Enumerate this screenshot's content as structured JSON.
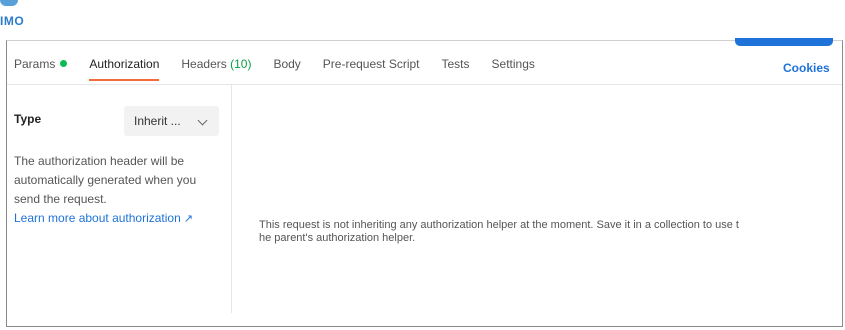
{
  "header": {
    "logo_text": "IMO"
  },
  "tabs": [
    {
      "label": "Params",
      "has_dot": true,
      "active": false
    },
    {
      "label": "Authorization",
      "active": true
    },
    {
      "label": "Headers",
      "count": "(10)",
      "active": false
    },
    {
      "label": "Body",
      "active": false
    },
    {
      "label": "Pre-request Script",
      "active": false
    },
    {
      "label": "Tests",
      "active": false
    },
    {
      "label": "Settings",
      "active": false
    }
  ],
  "cookies_label": "Cookies",
  "auth": {
    "type_label": "Type",
    "type_value": "Inherit ...",
    "description_lines": [
      "The authorization header will be",
      "automatically generated when you",
      "send the request."
    ],
    "learn_more_label": "Learn more about authorization",
    "learn_more_icon": "external-link-arrow-icon",
    "message_lines": [
      "This request is not inheriting any authorization helper at the moment. Save it in a collection to use t",
      "he parent's authorization helper."
    ]
  },
  "colors": {
    "accent_blue": "#1f73d8",
    "active_tab_underline": "#f26b3a",
    "params_dot": "#0cbb52"
  }
}
